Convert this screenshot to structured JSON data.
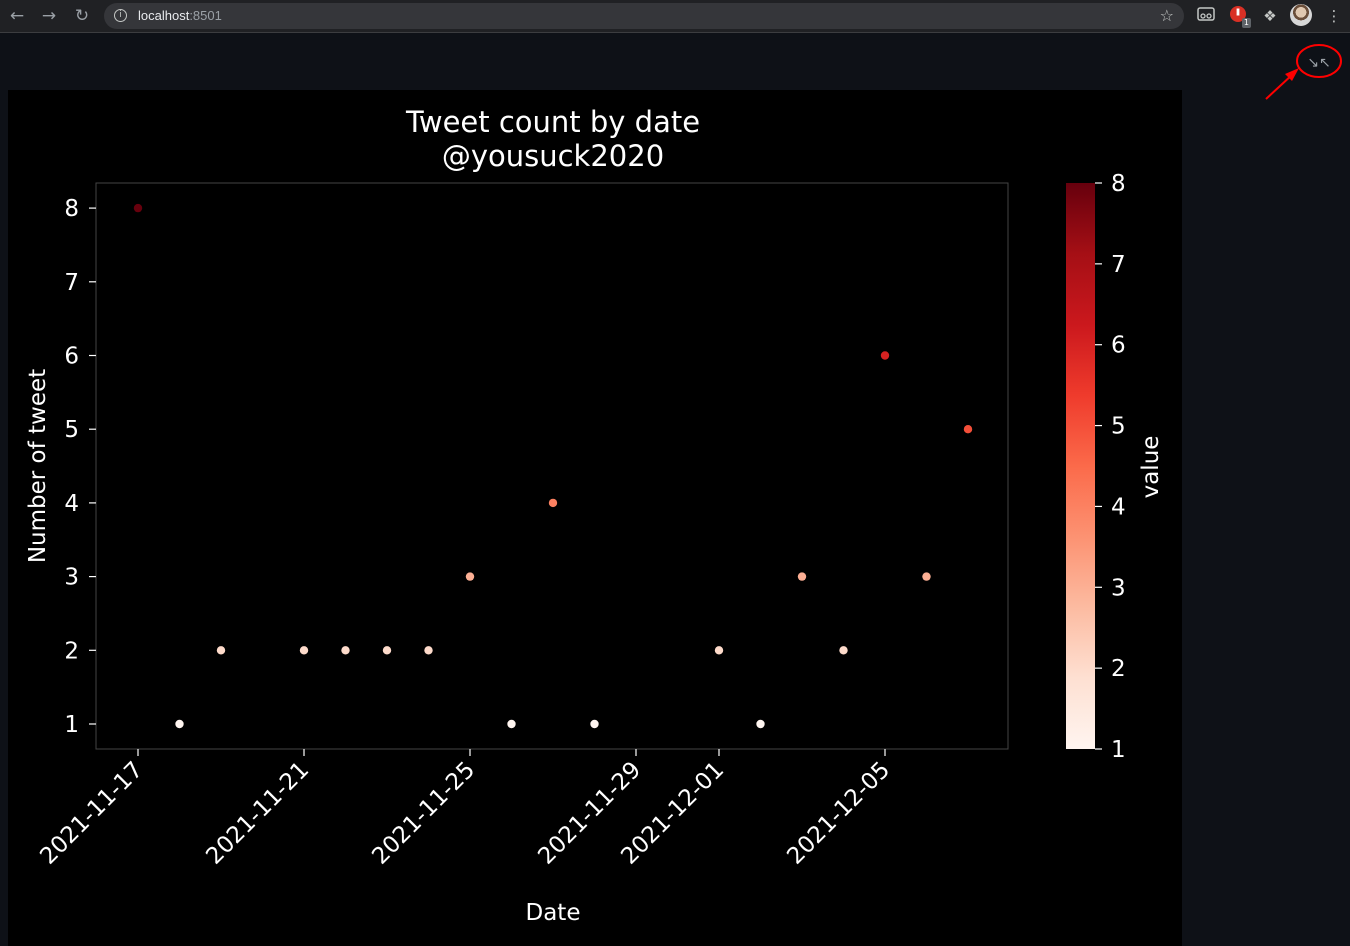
{
  "browser": {
    "url_host": "localhost",
    "url_port": ":8501",
    "extension_badge": "1"
  },
  "icons": {
    "back": "arrow-left-icon",
    "forward": "arrow-right-icon",
    "reload": "reload-icon",
    "info": "info-icon",
    "bookmark": "star-icon",
    "extension_glasses": "glasses-icon",
    "extension_red": "red-extension-icon",
    "extensions": "puzzle-icon",
    "menu": "kebab-menu-icon",
    "fullscreen": "exit-fullscreen-icon"
  },
  "colors": {
    "page_bg": "#0e1117",
    "figure_bg": "#000000",
    "text": "#ffffff",
    "annotation": "#ff0000"
  },
  "chart_data": {
    "type": "scatter",
    "title": "Tweet count by date",
    "subtitle": "@yousuck2020",
    "xlabel": "Date",
    "ylabel": "Number of tweet",
    "colorbar_label": "value",
    "colormap": "Reds",
    "x_ticks": [
      "2021-11-17",
      "2021-11-21",
      "2021-11-25",
      "2021-11-29",
      "2021-12-01",
      "2021-12-05"
    ],
    "y_ticks": [
      1,
      2,
      3,
      4,
      5,
      6,
      7,
      8
    ],
    "colorbar_ticks": [
      1,
      2,
      3,
      4,
      5,
      6,
      7,
      8
    ],
    "grid": false,
    "points": [
      {
        "x": "2021-11-17",
        "y": 8
      },
      {
        "x": "2021-11-18",
        "y": 1
      },
      {
        "x": "2021-11-19",
        "y": 2
      },
      {
        "x": "2021-11-21",
        "y": 2
      },
      {
        "x": "2021-11-22",
        "y": 2
      },
      {
        "x": "2021-11-23",
        "y": 2
      },
      {
        "x": "2021-11-24",
        "y": 2
      },
      {
        "x": "2021-11-25",
        "y": 3
      },
      {
        "x": "2021-11-26",
        "y": 1
      },
      {
        "x": "2021-11-27",
        "y": 4
      },
      {
        "x": "2021-11-28",
        "y": 1
      },
      {
        "x": "2021-12-01",
        "y": 2
      },
      {
        "x": "2021-12-02",
        "y": 1
      },
      {
        "x": "2021-12-03",
        "y": 3
      },
      {
        "x": "2021-12-04",
        "y": 2
      },
      {
        "x": "2021-12-05",
        "y": 6
      },
      {
        "x": "2021-12-06",
        "y": 3
      },
      {
        "x": "2021-12-07",
        "y": 5
      }
    ]
  }
}
